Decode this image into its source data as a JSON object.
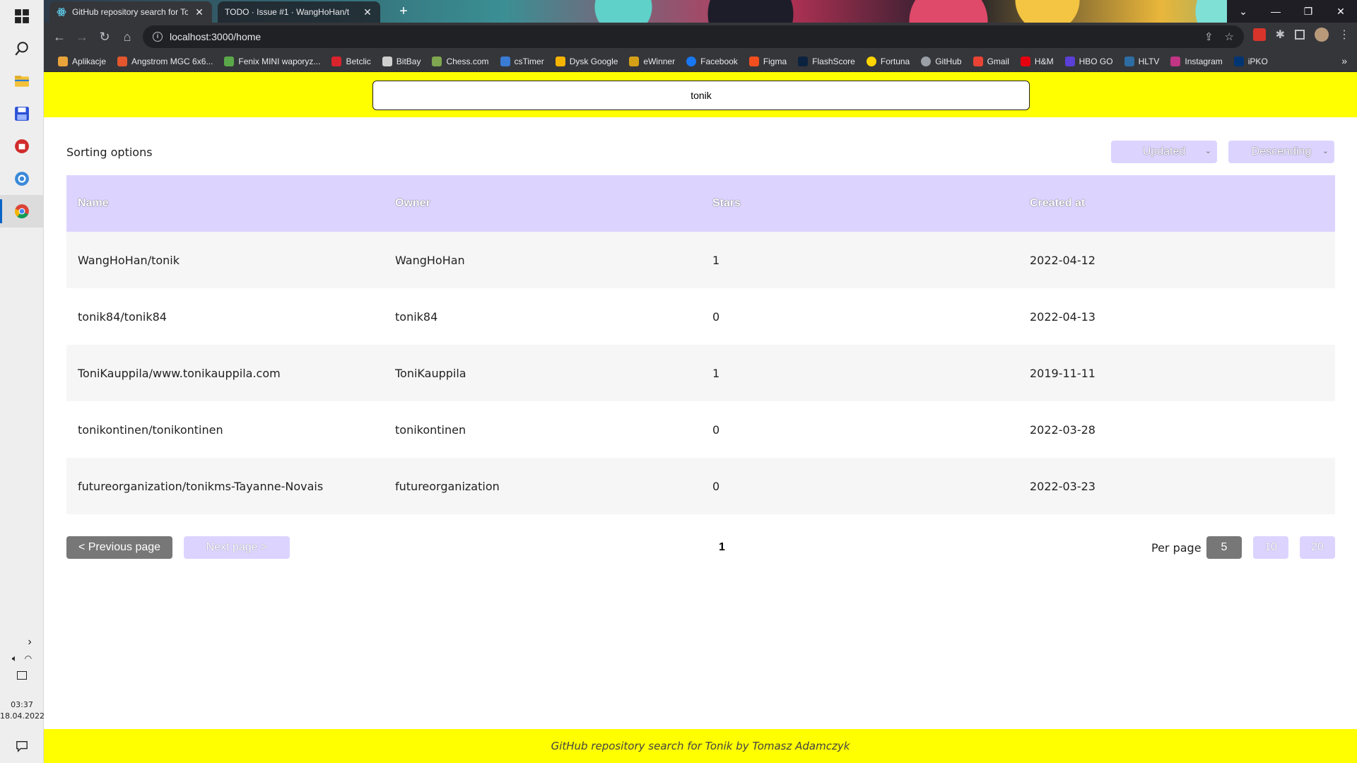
{
  "taskbar": {
    "time": "03:37",
    "date": "18.04.2022"
  },
  "browser": {
    "tabs": [
      {
        "title": "GitHub repository search for Toni",
        "active": true
      },
      {
        "title": "TODO · Issue #1 · WangHoHan/t",
        "active": false
      }
    ],
    "url": "localhost:3000/home",
    "bookmarks": [
      {
        "label": "Aplikacje",
        "color": "#e8a33a"
      },
      {
        "label": "Angstrom MGC 6x6...",
        "color": "#e4572e"
      },
      {
        "label": "Fenix MINI waporyz...",
        "color": "#5aa84a"
      },
      {
        "label": "Betclic",
        "color": "#d9242e"
      },
      {
        "label": "BitBay",
        "color": "#cfcfcf"
      },
      {
        "label": "Chess.com",
        "color": "#7fa650"
      },
      {
        "label": "csTimer",
        "color": "#3a7bd5"
      },
      {
        "label": "Dysk Google",
        "color": "#f4b400"
      },
      {
        "label": "eWinner",
        "color": "#d4a017"
      },
      {
        "label": "Facebook",
        "color": "#1877f2"
      },
      {
        "label": "Figma",
        "color": "#f24e1e"
      },
      {
        "label": "FlashScore",
        "color": "#0c2340"
      },
      {
        "label": "Fortuna",
        "color": "#ffd400"
      },
      {
        "label": "GitHub",
        "color": "#24292e"
      },
      {
        "label": "Gmail",
        "color": "#ea4335"
      },
      {
        "label": "H&M",
        "color": "#e50010"
      },
      {
        "label": "HBO GO",
        "color": "#5b3fd6"
      },
      {
        "label": "HLTV",
        "color": "#2d6da3"
      },
      {
        "label": "Instagram",
        "color": "#c13584"
      },
      {
        "label": "iPKO",
        "color": "#003574"
      }
    ]
  },
  "search": {
    "value": "tonik"
  },
  "sorting": {
    "label": "Sorting options",
    "sort_by": "Updated",
    "order": "Descending"
  },
  "table": {
    "headers": [
      "Name",
      "Owner",
      "Stars",
      "Created at"
    ],
    "rows": [
      {
        "name": "WangHoHan/tonik",
        "owner": "WangHoHan",
        "stars": "1",
        "created": "2022-04-12"
      },
      {
        "name": "tonik84/tonik84",
        "owner": "tonik84",
        "stars": "0",
        "created": "2022-04-13"
      },
      {
        "name": "ToniKauppila/www.tonikauppila.com",
        "owner": "ToniKauppila",
        "stars": "1",
        "created": "2019-11-11"
      },
      {
        "name": "tonikontinen/tonikontinen",
        "owner": "tonikontinen",
        "stars": "0",
        "created": "2022-03-28"
      },
      {
        "name": "futureorganization/tonikms-Tayanne-Novais",
        "owner": "futureorganization",
        "stars": "0",
        "created": "2022-03-23"
      }
    ]
  },
  "pagination": {
    "prev_label": "< Previous page",
    "next_label": "Next page >",
    "current_page": "1",
    "per_page_label": "Per page",
    "per_page_options": [
      "5",
      "10",
      "20"
    ],
    "per_page_selected": "5"
  },
  "footer": {
    "text": "GitHub repository search for Tonik by Tomasz Adamczyk"
  },
  "colors": {
    "accent_yellow": "#ffff00",
    "lavender": "#dcd4ff",
    "active_gray": "#777777"
  }
}
